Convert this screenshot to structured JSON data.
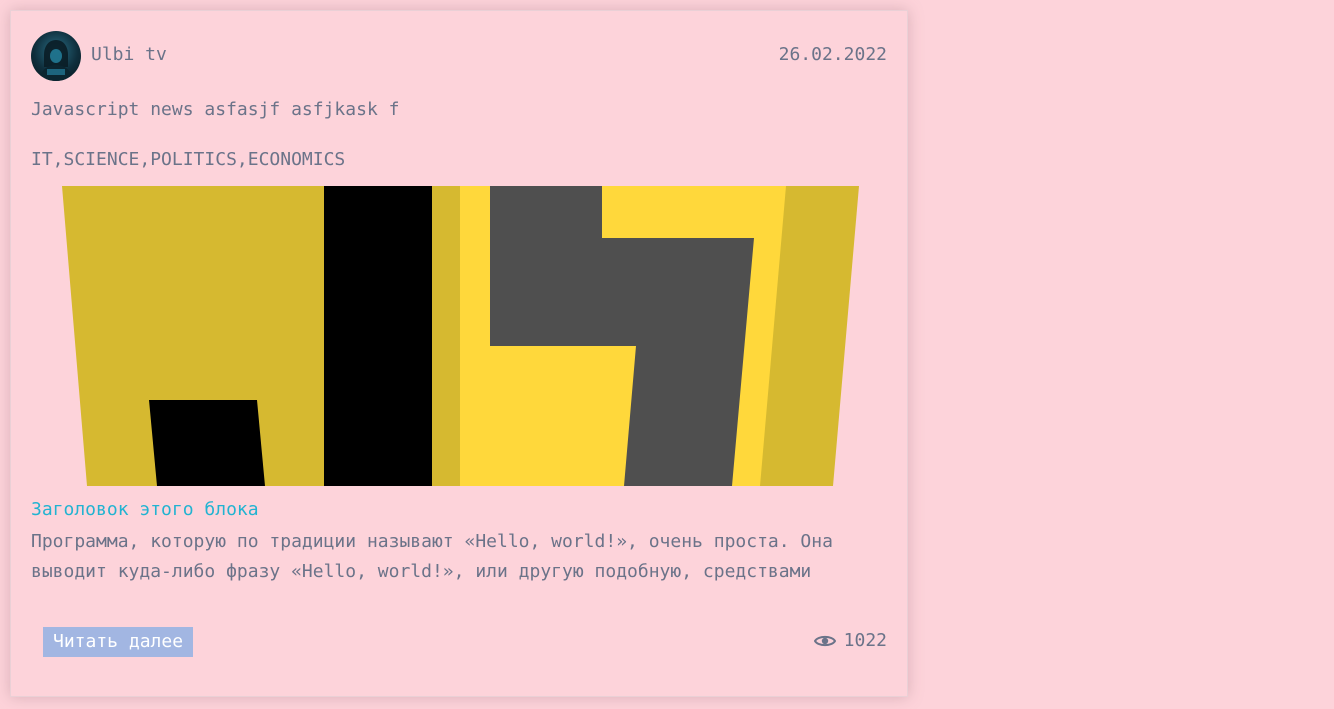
{
  "post": {
    "author": "Ulbi tv",
    "date": "26.02.2022",
    "title": "Javascript news asfasjf asfjkask f",
    "tags": "IT,SCIENCE,POLITICS,ECONOMICS",
    "block_heading": "Заголовок этого блока",
    "block_text": "Программа, которую по традиции называют «Hello, world!», очень проста. Она выводит куда-либо фразу «Hello, world!», или другую подобную, средствами",
    "read_more_label": "Читать далее",
    "views": "1022"
  },
  "icons": {
    "avatar": "hooded-figure-avatar",
    "views": "eye-icon"
  },
  "colors": {
    "background": "#fdd3da",
    "text": "#6b7389",
    "heading_accent": "#22b3d1",
    "button": "#a2b6e2",
    "js_yellow": "#ffd83b",
    "js_yellow_shadow": "#d6b930",
    "js_dark": "#4f4f4f"
  }
}
